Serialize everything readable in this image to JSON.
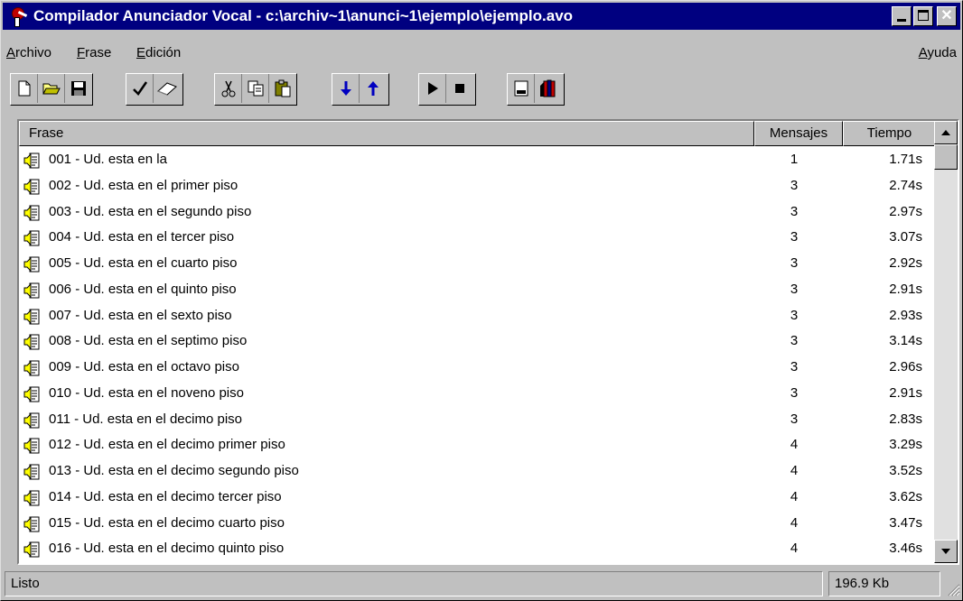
{
  "window": {
    "title": "Compilador Anunciador Vocal - c:\\archiv~1\\anunci~1\\ejemplo\\ejemplo.avo"
  },
  "menu": {
    "archivo": {
      "first": "A",
      "rest": "rchivo"
    },
    "frase": {
      "first": "F",
      "rest": "rase"
    },
    "edicion": {
      "first": "E",
      "rest": "dición"
    },
    "ayuda": {
      "first": "A",
      "rest": "yuda"
    }
  },
  "list": {
    "columns": {
      "frase": "Frase",
      "mensajes": "Mensajes",
      "tiempo": "Tiempo"
    },
    "rows": [
      {
        "name": "001 - Ud. esta en la",
        "mensajes": "1",
        "tiempo": "1.71s"
      },
      {
        "name": "002 - Ud. esta en el primer piso",
        "mensajes": "3",
        "tiempo": "2.74s"
      },
      {
        "name": "003 - Ud. esta en el segundo piso",
        "mensajes": "3",
        "tiempo": "2.97s"
      },
      {
        "name": "004 - Ud. esta en el tercer piso",
        "mensajes": "3",
        "tiempo": "3.07s"
      },
      {
        "name": "005 - Ud. esta en el cuarto piso",
        "mensajes": "3",
        "tiempo": "2.92s"
      },
      {
        "name": "006 - Ud. esta en el quinto piso",
        "mensajes": "3",
        "tiempo": "2.91s"
      },
      {
        "name": "007 - Ud. esta en el sexto piso",
        "mensajes": "3",
        "tiempo": "2.93s"
      },
      {
        "name": "008 - Ud. esta en el septimo piso",
        "mensajes": "3",
        "tiempo": "3.14s"
      },
      {
        "name": "009 - Ud. esta en el octavo piso",
        "mensajes": "3",
        "tiempo": "2.96s"
      },
      {
        "name": "010 - Ud. esta en el noveno piso",
        "mensajes": "3",
        "tiempo": "2.91s"
      },
      {
        "name": "011 - Ud. esta en el decimo piso",
        "mensajes": "3",
        "tiempo": "2.83s"
      },
      {
        "name": "012 - Ud. esta en el decimo primer piso",
        "mensajes": "4",
        "tiempo": "3.29s"
      },
      {
        "name": "013 - Ud. esta en el decimo segundo piso",
        "mensajes": "4",
        "tiempo": "3.52s"
      },
      {
        "name": "014 - Ud. esta en el decimo tercer piso",
        "mensajes": "4",
        "tiempo": "3.62s"
      },
      {
        "name": "015 - Ud. esta en el decimo cuarto piso",
        "mensajes": "4",
        "tiempo": "3.47s"
      },
      {
        "name": "016 - Ud. esta en el decimo quinto piso",
        "mensajes": "4",
        "tiempo": "3.46s"
      }
    ]
  },
  "status": {
    "text": "Listo",
    "size": "196.9 Kb"
  },
  "icons": {
    "toolbar": [
      "new-file-icon",
      "open-folder-icon",
      "save-disk-icon",
      "check-compile-icon",
      "eraser-icon",
      "cut-scissors-icon",
      "copy-icon",
      "paste-icon",
      "move-down-icon",
      "move-up-icon",
      "play-icon",
      "stop-icon",
      "window-icon",
      "books-icon"
    ],
    "row": "speaker-document-icon"
  },
  "colors": {
    "titlebar": "#000080",
    "face": "#c0c0c0",
    "arrow_blue": "#0000c0"
  }
}
